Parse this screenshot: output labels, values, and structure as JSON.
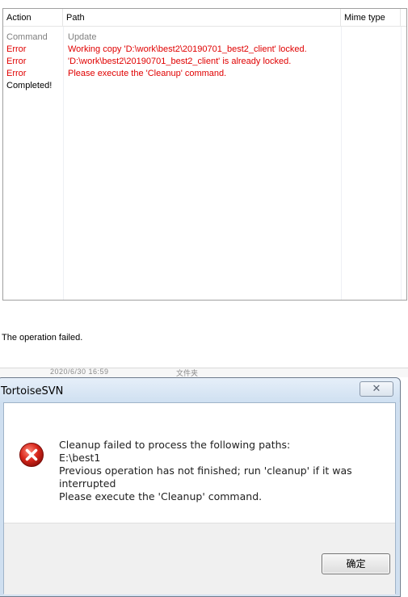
{
  "log": {
    "columns": {
      "action": "Action",
      "path": "Path",
      "mime": "Mime type"
    },
    "rows": [
      {
        "action": "Command",
        "path": "Update",
        "tone": "gray"
      },
      {
        "action": "Error",
        "path": "Working copy 'D:\\work\\best2\\20190701_best2_client' locked.",
        "tone": "red"
      },
      {
        "action": "Error",
        "path": "'D:\\work\\best2\\20190701_best2_client' is already locked.",
        "tone": "red"
      },
      {
        "action": "Error",
        "path": "Please execute the 'Cleanup' command.",
        "tone": "red"
      },
      {
        "action": "Completed!",
        "path": "",
        "tone": "black"
      }
    ],
    "colors": {
      "error": "#e00000",
      "command": "#808080"
    }
  },
  "status": {
    "text": "The operation failed."
  },
  "background": {
    "date_fragment": "2020/6/30 16:59",
    "type_fragment": "文件夹"
  },
  "dialog": {
    "title": "TortoiseSVN",
    "close_glyph": "✕",
    "icon": "error-circle-icon",
    "messages": [
      "Cleanup failed to process the following paths:",
      "E:\\best1",
      "Previous operation has not finished; run 'cleanup' if it was",
      "interrupted",
      "Please execute the 'Cleanup' command."
    ],
    "ok_label": "确定"
  }
}
